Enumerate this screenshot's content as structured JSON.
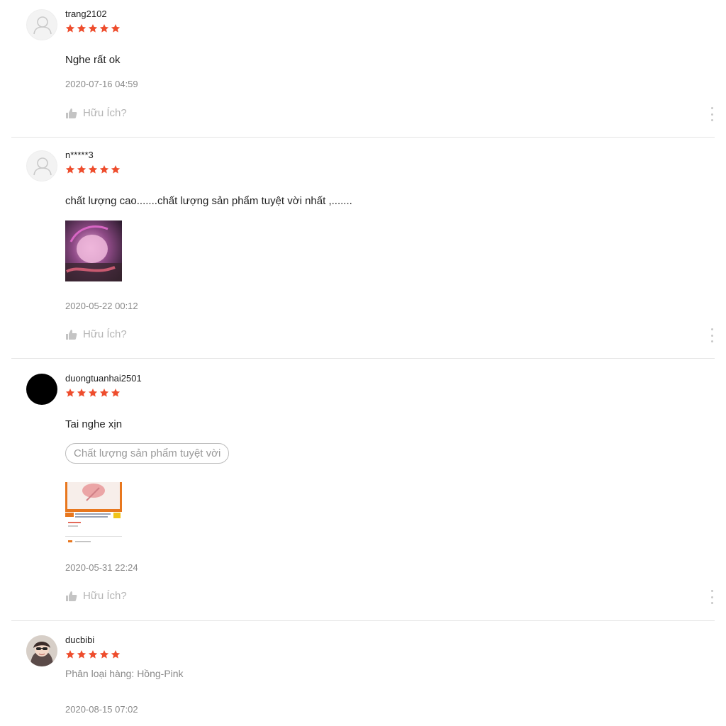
{
  "colors": {
    "star": "#ee4d2d",
    "muted": "#8a8a8a",
    "divider": "#e5e5e5"
  },
  "reviews": [
    {
      "username": "trang2102",
      "rating": 5,
      "comment": "Nghe rất ok",
      "date": "2020-07-16 04:59",
      "helpful_label": "Hữu Ích?"
    },
    {
      "username": "n*****3",
      "rating": 5,
      "comment": "chất lượng cao.......chất lượng sản phẩm tuyệt vời nhất ,.......",
      "date": "2020-05-22 00:12",
      "helpful_label": "Hữu Ích?"
    },
    {
      "username": "duongtuanhai2501",
      "rating": 5,
      "comment": "Tai nghe xịn",
      "tag": "Chất lượng sản phẩm tuyệt vời",
      "date": "2020-05-31 22:24",
      "helpful_label": "Hữu Ích?"
    },
    {
      "username": "ducbibi",
      "rating": 5,
      "variation": "Phân loại hàng: Hồng-Pink",
      "date": "2020-08-15 07:02"
    }
  ],
  "icons": {
    "star": "star-icon",
    "thumb": "thumbs-up-icon",
    "more": "more-vertical-icon",
    "avatar": "user-icon"
  }
}
